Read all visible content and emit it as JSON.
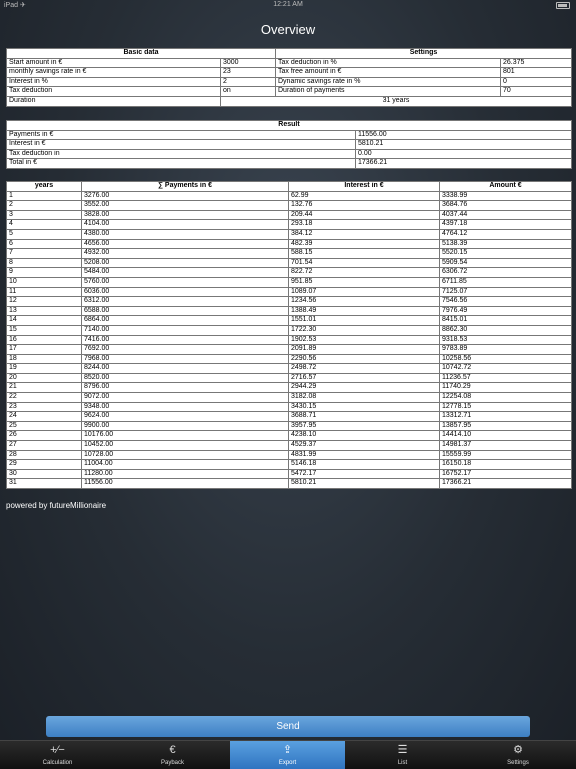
{
  "status": {
    "left": "iPad ✈",
    "time": "12:21 AM"
  },
  "title": "Overview",
  "basic": {
    "header_left": "Basic data",
    "header_right": "Settings",
    "rows": [
      {
        "l1": "Start amount in €",
        "v1": "3000",
        "l2": "Tax deduction in %",
        "v2": "26.375"
      },
      {
        "l1": "monthly savings rate in €",
        "v1": "23",
        "l2": "Tax free amount in €",
        "v2": "801"
      },
      {
        "l1": "Interest in %",
        "v1": "2",
        "l2": "Dynamic savings rate in %",
        "v2": "0"
      },
      {
        "l1": "Tax deduction",
        "v1": "on",
        "l2": "Duration of payments",
        "v2": "70"
      }
    ],
    "duration_label": "Duration",
    "duration_value": "31 years"
  },
  "result": {
    "header": "Result",
    "rows": [
      {
        "label": "Payments in €",
        "value": "11556.00"
      },
      {
        "label": "Interest in €",
        "value": "5810.21"
      },
      {
        "label": "Tax deduction in",
        "value": "0.00"
      },
      {
        "label": "Total in €",
        "value": "17366.21"
      }
    ]
  },
  "years_table": {
    "headers": [
      "years",
      "∑ Payments in €",
      "Interest in €",
      "Amount €"
    ],
    "rows": [
      [
        "1",
        "3276.00",
        "62.99",
        "3338.99"
      ],
      [
        "2",
        "3552.00",
        "132.76",
        "3684.76"
      ],
      [
        "3",
        "3828.00",
        "209.44",
        "4037.44"
      ],
      [
        "4",
        "4104.00",
        "293.18",
        "4397.18"
      ],
      [
        "5",
        "4380.00",
        "384.12",
        "4764.12"
      ],
      [
        "6",
        "4656.00",
        "482.39",
        "5138.39"
      ],
      [
        "7",
        "4932.00",
        "588.15",
        "5520.15"
      ],
      [
        "8",
        "5208.00",
        "701.54",
        "5909.54"
      ],
      [
        "9",
        "5484.00",
        "822.72",
        "6306.72"
      ],
      [
        "10",
        "5760.00",
        "951.85",
        "6711.85"
      ],
      [
        "11",
        "6036.00",
        "1089.07",
        "7125.07"
      ],
      [
        "12",
        "6312.00",
        "1234.56",
        "7546.56"
      ],
      [
        "13",
        "6588.00",
        "1388.49",
        "7976.49"
      ],
      [
        "14",
        "6864.00",
        "1551.01",
        "8415.01"
      ],
      [
        "15",
        "7140.00",
        "1722.30",
        "8862.30"
      ],
      [
        "16",
        "7416.00",
        "1902.53",
        "9318.53"
      ],
      [
        "17",
        "7692.00",
        "2091.89",
        "9783.89"
      ],
      [
        "18",
        "7968.00",
        "2290.56",
        "10258.56"
      ],
      [
        "19",
        "8244.00",
        "2498.72",
        "10742.72"
      ],
      [
        "20",
        "8520.00",
        "2716.57",
        "11236.57"
      ],
      [
        "21",
        "8796.00",
        "2944.29",
        "11740.29"
      ],
      [
        "22",
        "9072.00",
        "3182.08",
        "12254.08"
      ],
      [
        "23",
        "9348.00",
        "3430.15",
        "12778.15"
      ],
      [
        "24",
        "9624.00",
        "3688.71",
        "13312.71"
      ],
      [
        "25",
        "9900.00",
        "3957.95",
        "13857.95"
      ],
      [
        "26",
        "10176.00",
        "4238.10",
        "14414.10"
      ],
      [
        "27",
        "10452.00",
        "4529.37",
        "14981.37"
      ],
      [
        "28",
        "10728.00",
        "4831.99",
        "15559.99"
      ],
      [
        "29",
        "11004.00",
        "5146.18",
        "16150.18"
      ],
      [
        "30",
        "11280.00",
        "5472.17",
        "16752.17"
      ],
      [
        "31",
        "11556.00",
        "5810.21",
        "17366.21"
      ]
    ]
  },
  "powered_by": "powered by futureMillionaire",
  "send_label": "Send",
  "tabs": [
    {
      "label": "Calculation",
      "icon": "calculator-icon",
      "glyph": "+⁄−"
    },
    {
      "label": "Payback",
      "icon": "euro-icon",
      "glyph": "€"
    },
    {
      "label": "Export",
      "icon": "share-icon",
      "glyph": "⇪"
    },
    {
      "label": "List",
      "icon": "list-icon",
      "glyph": "☰"
    },
    {
      "label": "Settings",
      "icon": "gear-icon",
      "glyph": "⚙"
    }
  ],
  "active_tab": "Export"
}
